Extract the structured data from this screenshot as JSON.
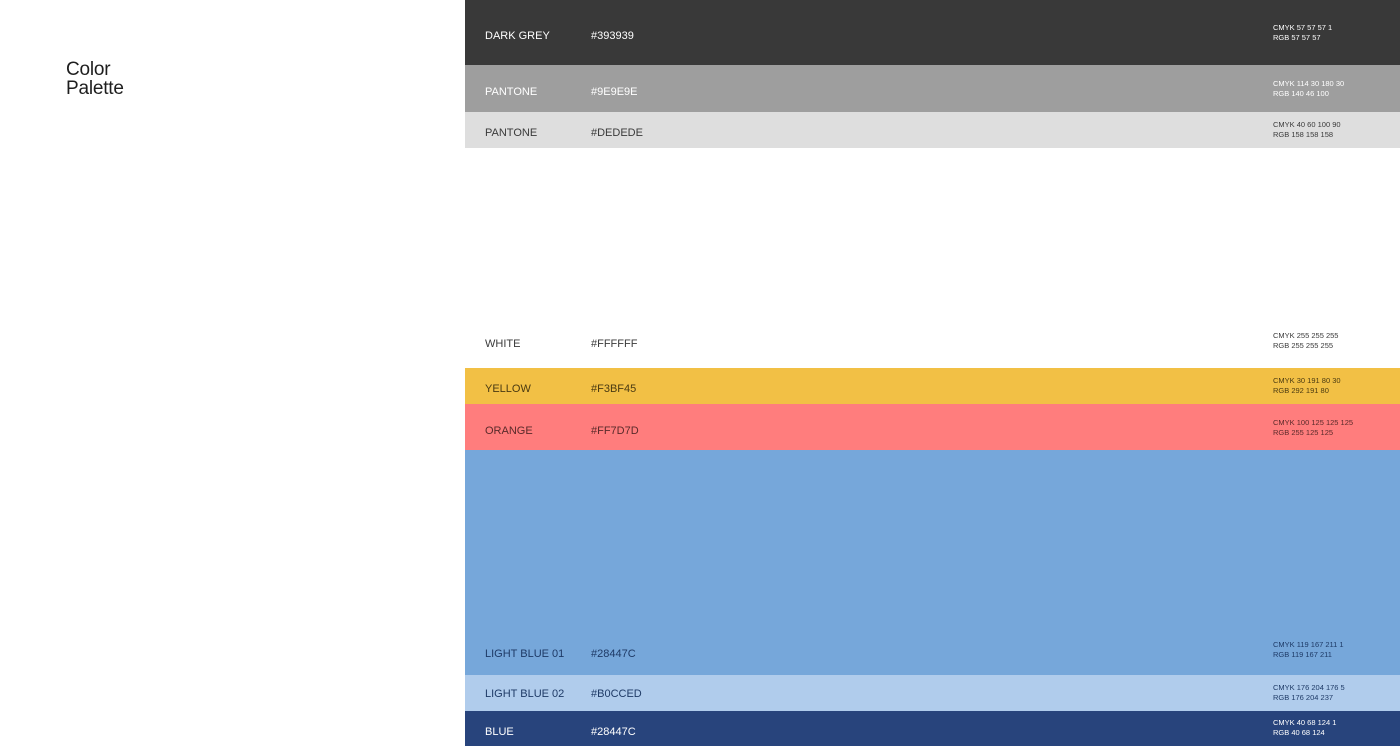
{
  "title": {
    "line1": "Color",
    "line2": "Palette"
  },
  "swatches": [
    {
      "name": "DARK GREY",
      "hex": "#393939",
      "bg": "#393939",
      "text": "#ffffff",
      "cmyk": "CMYK   57   57   57   1",
      "rgb": "RGB   57   57   57"
    },
    {
      "name": "PANTONE",
      "hex": "#9E9E9E",
      "bg": "#9e9e9e",
      "text": "#ffffff",
      "cmyk": "CMYK   114   30   180   30",
      "rgb": "RGB   140   46   100"
    },
    {
      "name": "PANTONE",
      "hex": "#DEDEDE",
      "bg": "#dedede",
      "text": "#3a3a3a",
      "cmyk": "CMYK   40   60   100   90",
      "rgb": "RGB   158   158   158"
    },
    {
      "name": "WHITE",
      "hex": "#FFFFFF",
      "bg": "#ffffff",
      "text": "#3a3a3a",
      "cmyk": "CMYK   255   255   255",
      "rgb": "RGB   255   255   255"
    },
    {
      "name": "YELLOW",
      "hex": "#F3BF45",
      "bg": "#f2c045",
      "text": "#4a3a12",
      "cmyk": "CMYK   30   191   80   30",
      "rgb": "RGB   292   191   80"
    },
    {
      "name": "ORANGE",
      "hex": "#FF7D7D",
      "bg": "#ff7d7d",
      "text": "#5a2a2a",
      "cmyk": "CMYK   100   125   125   125",
      "rgb": "RGB   255   125   125"
    },
    {
      "name": "LIGHT BLUE 01",
      "hex": "#28447C",
      "bg": "#76a7da",
      "text": "#1e3a66",
      "cmyk": "CMYK   119   167   211   1",
      "rgb": "RGB   119   167   211"
    },
    {
      "name": "LIGHT BLUE 02",
      "hex": "#B0CCED",
      "bg": "#b0ccec",
      "text": "#1e3a66",
      "cmyk": "CMYK   176   204   176   5",
      "rgb": "RGB   176   204   237"
    },
    {
      "name": "BLUE",
      "hex": "#28447C",
      "bg": "#28447c",
      "text": "#ffffff",
      "cmyk": "CMYK   40   68   124   1",
      "rgb": "RGB   40   68   124"
    }
  ]
}
